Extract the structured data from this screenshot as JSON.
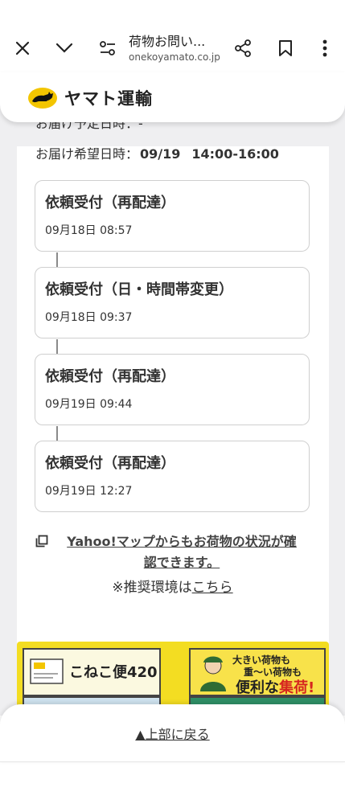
{
  "browser": {
    "tab_title": "荷物お問い...",
    "url": "onekoyamato.co.jp"
  },
  "header": {
    "logo_text": "ヤマト運輸"
  },
  "delivery": {
    "scheduled_cut": "お届け予定日時：-",
    "desired_label": "お届け希望日時：",
    "desired_date": "09/19",
    "desired_time": "14:00-16:00"
  },
  "timeline": [
    {
      "label": "依頼受付（再配達）",
      "datetime": "09月18日 08:57"
    },
    {
      "label": "依頼受付（日・時間帯変更）",
      "datetime": "09月18日 09:37"
    },
    {
      "label": "依頼受付（再配達）",
      "datetime": "09月19日 09:44"
    },
    {
      "label": "依頼受付（再配達）",
      "datetime": "09月19日 12:27"
    }
  ],
  "links": {
    "map_line1": "Yahoo!マップからもお荷物の状況が確",
    "map_line2": "認できます。",
    "env_prefix": "※推奨環境は",
    "env_link": "こちら"
  },
  "banners": {
    "left_text": "こねこ便420",
    "right_line1": "大きい荷物も",
    "right_line2": "重～い荷物も",
    "right_line3a": "便利な",
    "right_line3b": "集荷!"
  },
  "footer": {
    "back_to_top": "▲上部に戻る"
  },
  "colors": {
    "logo_yellow": "#f3c500",
    "banner_yellow": "#f3dd22",
    "accent_red": "#d6261f"
  }
}
